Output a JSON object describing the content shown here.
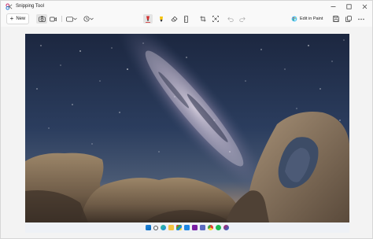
{
  "window": {
    "title": "Snipping Tool"
  },
  "toolbar": {
    "new_label": "New",
    "edit_in_paint_label": "Edit in Paint",
    "icons": [
      "camera-icon",
      "video-icon",
      "rectangle-mode-icon",
      "timer-icon",
      "ballpoint-pen-icon",
      "highlighter-icon",
      "eraser-icon",
      "ruler-icon",
      "crop-icon",
      "text-actions-icon",
      "undo-icon",
      "redo-icon",
      "paint-icon",
      "save-icon",
      "copy-icon",
      "share-icon"
    ]
  },
  "colors": {
    "pen": "#d32f2f",
    "highlighter": "#f4c20d",
    "accent": "#0067c0",
    "sky_top": "#1e2a44",
    "rock": "#8a7560"
  },
  "taskbar": {
    "icons": [
      "windows-icon",
      "search-icon",
      "edge-icon",
      "file-explorer-icon",
      "store-icon",
      "photos-icon",
      "onenote-icon",
      "teams-icon",
      "chrome-icon",
      "spotify-icon",
      "snipping-tool-icon"
    ]
  }
}
